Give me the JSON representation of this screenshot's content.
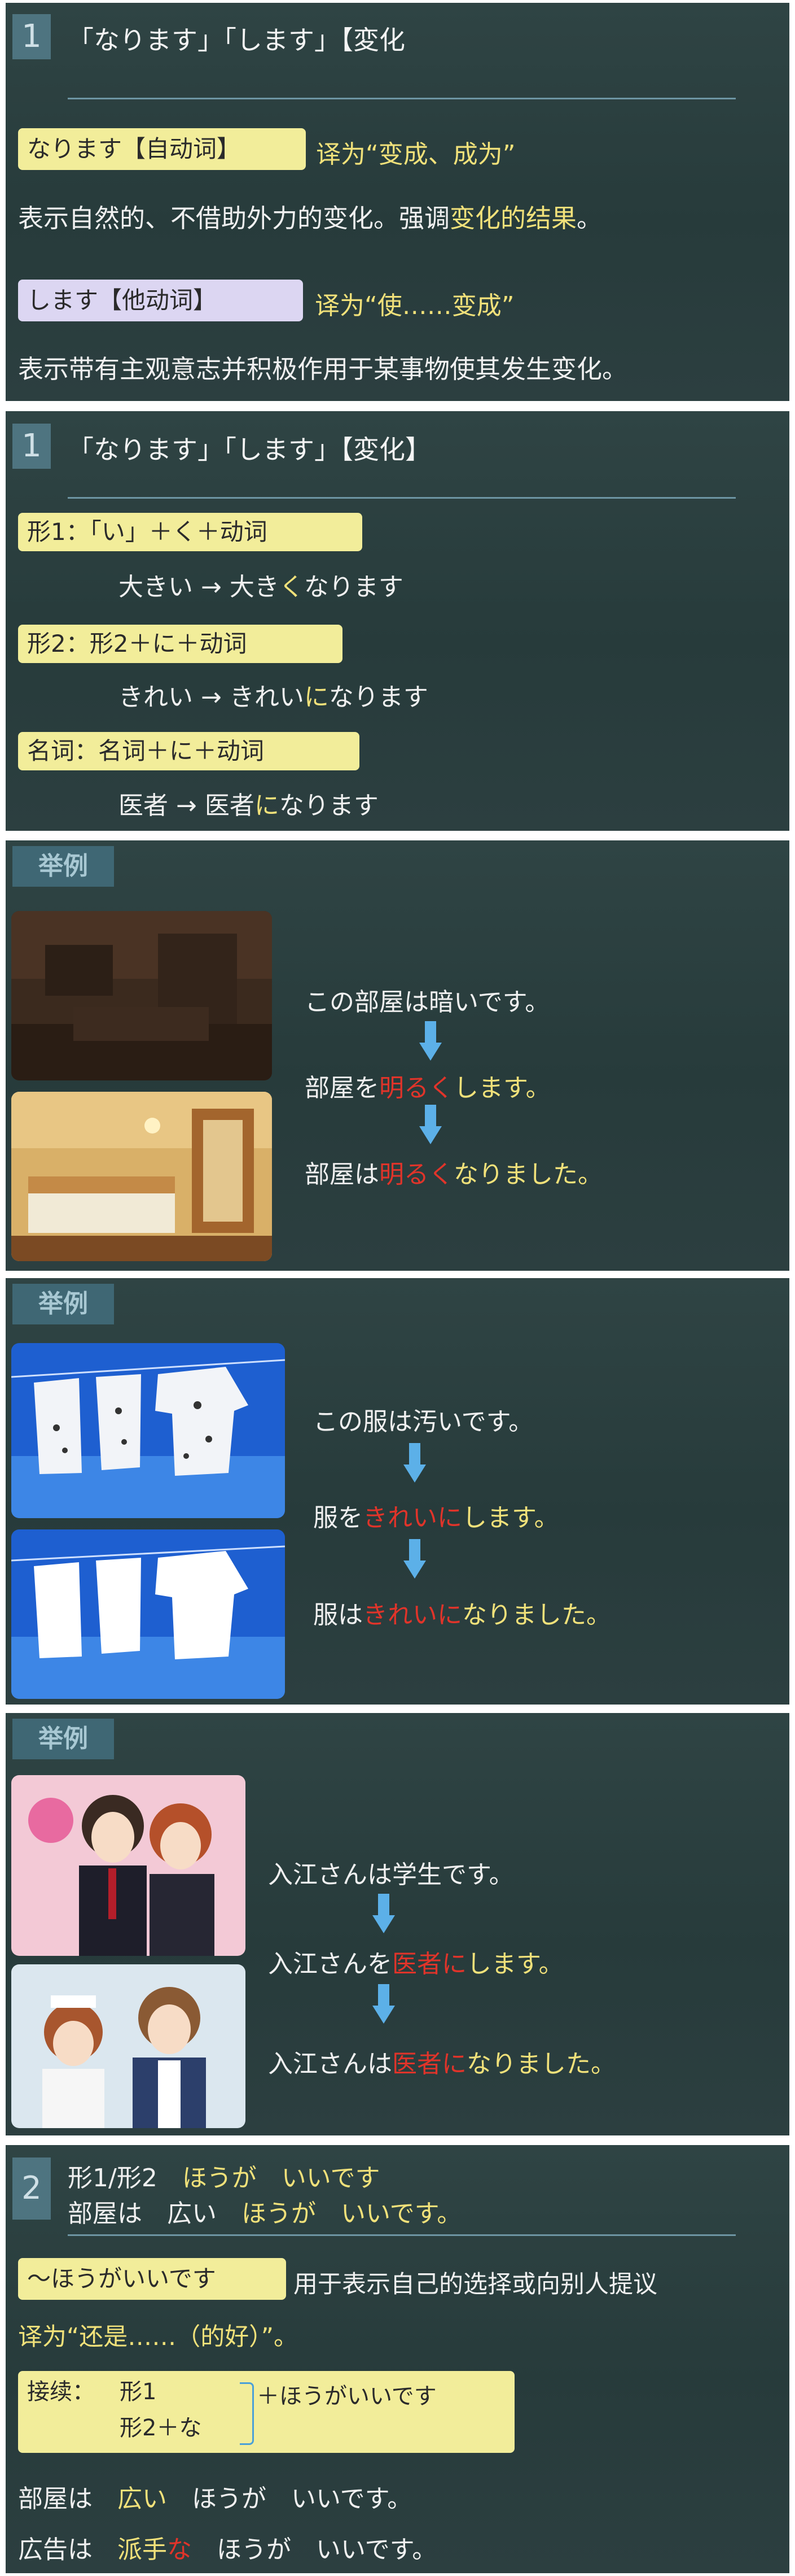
{
  "slide1": {
    "num": "1",
    "title": "「なります」「します」【変化",
    "naru_pill": "なります【自动词】",
    "naru_trans": "译为“变成、成为”",
    "naru_desc_a": "表示自然的、不借助外力的变化。强调",
    "naru_desc_b": "变化的结果",
    "naru_desc_c": "。",
    "suru_pill": "します【他动词】",
    "suru_trans": "译为“使……变成”",
    "suru_desc": "表示带有主观意志并积极作用于某事物使其发生变化。"
  },
  "slide2": {
    "num": "1",
    "title": "「なります」「します」【変化】",
    "rule1": "形1：「い」＋く＋动词",
    "ex1_a": "大きい → 大き",
    "ex1_b": "く",
    "ex1_c": "なります",
    "rule2": "形2：形2＋に＋动词",
    "ex2_a": "きれい → きれい",
    "ex2_b": "に",
    "ex2_c": "なります",
    "rule3": "名词：名词＋に＋动词",
    "ex3_a": "医者 → 医者",
    "ex3_b": "に",
    "ex3_c": "なります"
  },
  "slide3": {
    "tag": "举例",
    "line1": "この部屋は暗いです。",
    "line2_a": "部屋を",
    "line2_b": "明るく",
    "line2_c": "します。",
    "line3_a": "部屋は",
    "line3_b": "明るく",
    "line3_c": "なりました。"
  },
  "slide4": {
    "tag": "举例",
    "line1": "この服は汚いです。",
    "line2_a": "服を",
    "line2_b": "きれいに",
    "line2_c": "します。",
    "line3_a": "服は",
    "line3_b": "きれいに",
    "line3_c": "なりました。"
  },
  "slide5": {
    "tag": "举例",
    "line1": "入江さんは学生です。",
    "line2_a": "入江さんを",
    "line2_b": "医者に",
    "line2_c": "します。",
    "line3_a": "入江さんは",
    "line3_b": "医者に",
    "line3_c": "なりました。"
  },
  "slide6": {
    "num": "2",
    "head1_a": "形1/形2",
    "head1_b": "ほうが　いいです",
    "head2_a": "部屋は　広い　",
    "head2_b": "ほうが　いいです。",
    "pill": "～ほうがいいです",
    "usage": "用于表示自己的选择或向别人提议",
    "trans": "译为“还是……（的好）”。",
    "conn_label": "接续：",
    "conn_a": "形1",
    "conn_b": "形2＋な",
    "conn_c": "＋ほうがいいです",
    "ex1_a": "部屋は　",
    "ex1_b": "広い",
    "ex1_c": "　ほうが　いいです。",
    "ex2_a": "広告は　",
    "ex2_b": "派手",
    "ex2_c": "な",
    "ex2_d": "　ほうが　いいです。"
  }
}
